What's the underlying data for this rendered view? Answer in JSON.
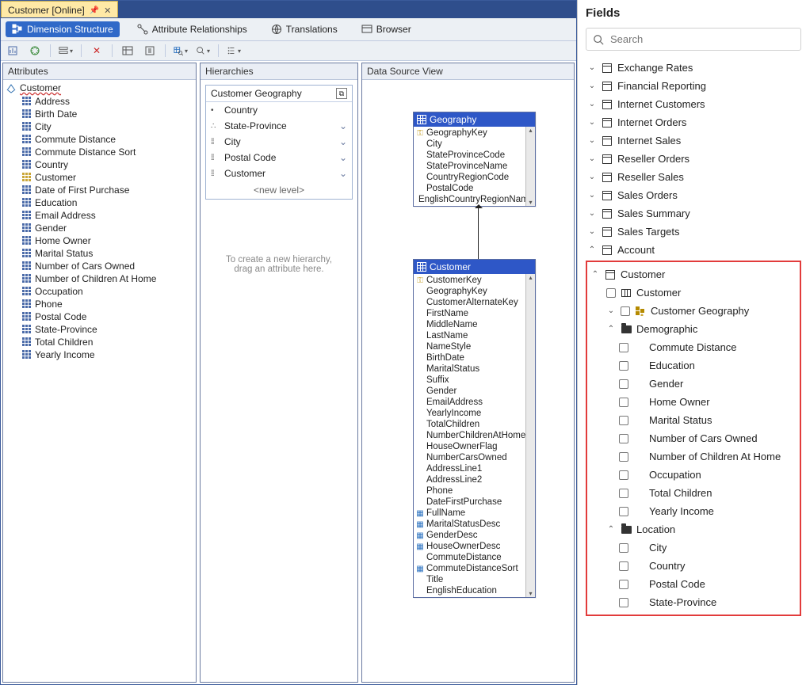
{
  "doc_tab": {
    "title": "Customer [Online]"
  },
  "designer_tabs": {
    "structure": "Dimension Structure",
    "attr_rel": "Attribute Relationships",
    "translations": "Translations",
    "browser": "Browser"
  },
  "panels": {
    "attributes_title": "Attributes",
    "hierarchies_title": "Hierarchies",
    "dsv_title": "Data Source View"
  },
  "attributes": {
    "root": "Customer",
    "items": [
      {
        "label": "Address",
        "key": false
      },
      {
        "label": "Birth Date",
        "key": false
      },
      {
        "label": "City",
        "key": false
      },
      {
        "label": "Commute Distance",
        "key": false
      },
      {
        "label": "Commute Distance Sort",
        "key": false
      },
      {
        "label": "Country",
        "key": false
      },
      {
        "label": "Customer",
        "key": true
      },
      {
        "label": "Date of First Purchase",
        "key": false
      },
      {
        "label": "Education",
        "key": false
      },
      {
        "label": "Email Address",
        "key": false
      },
      {
        "label": "Gender",
        "key": false
      },
      {
        "label": "Home Owner",
        "key": false
      },
      {
        "label": "Marital Status",
        "key": false
      },
      {
        "label": "Number of Cars Owned",
        "key": false
      },
      {
        "label": "Number of Children At Home",
        "key": false
      },
      {
        "label": "Occupation",
        "key": false
      },
      {
        "label": "Phone",
        "key": false
      },
      {
        "label": "Postal Code",
        "key": false
      },
      {
        "label": "State-Province",
        "key": false
      },
      {
        "label": "Total Children",
        "key": false
      },
      {
        "label": "Yearly Income",
        "key": false
      }
    ]
  },
  "hierarchy": {
    "name": "Customer Geography",
    "levels": [
      {
        "dots": "•",
        "label": "Country",
        "chev": false
      },
      {
        "dots": "∴",
        "label": "State-Province",
        "chev": true
      },
      {
        "dots": "⁞⁞",
        "label": "City",
        "chev": true
      },
      {
        "dots": "⁞⁞",
        "label": "Postal Code",
        "chev": true
      },
      {
        "dots": "⁞⁞",
        "label": "Customer",
        "chev": true
      }
    ],
    "new_level": "<new level>",
    "hint_line1": "To create a new hierarchy,",
    "hint_line2": "drag an attribute here."
  },
  "dsv": {
    "geo": {
      "name": "Geography",
      "cols": [
        {
          "n": "GeographyKey",
          "k": "key"
        },
        {
          "n": "City",
          "k": ""
        },
        {
          "n": "StateProvinceCode",
          "k": ""
        },
        {
          "n": "StateProvinceName",
          "k": ""
        },
        {
          "n": "CountryRegionCode",
          "k": ""
        },
        {
          "n": "PostalCode",
          "k": ""
        },
        {
          "n": "EnglishCountryRegionName",
          "k": ""
        }
      ]
    },
    "cust": {
      "name": "Customer",
      "cols": [
        {
          "n": "CustomerKey",
          "k": "key"
        },
        {
          "n": "GeographyKey",
          "k": ""
        },
        {
          "n": "CustomerAlternateKey",
          "k": ""
        },
        {
          "n": "FirstName",
          "k": ""
        },
        {
          "n": "MiddleName",
          "k": ""
        },
        {
          "n": "LastName",
          "k": ""
        },
        {
          "n": "NameStyle",
          "k": ""
        },
        {
          "n": "BirthDate",
          "k": ""
        },
        {
          "n": "MaritalStatus",
          "k": ""
        },
        {
          "n": "Suffix",
          "k": ""
        },
        {
          "n": "Gender",
          "k": ""
        },
        {
          "n": "EmailAddress",
          "k": ""
        },
        {
          "n": "YearlyIncome",
          "k": ""
        },
        {
          "n": "TotalChildren",
          "k": ""
        },
        {
          "n": "NumberChildrenAtHome",
          "k": ""
        },
        {
          "n": "HouseOwnerFlag",
          "k": ""
        },
        {
          "n": "NumberCarsOwned",
          "k": ""
        },
        {
          "n": "AddressLine1",
          "k": ""
        },
        {
          "n": "AddressLine2",
          "k": ""
        },
        {
          "n": "Phone",
          "k": ""
        },
        {
          "n": "DateFirstPurchase",
          "k": ""
        },
        {
          "n": "FullName",
          "k": "calc"
        },
        {
          "n": "MaritalStatusDesc",
          "k": "calc"
        },
        {
          "n": "GenderDesc",
          "k": "calc"
        },
        {
          "n": "HouseOwnerDesc",
          "k": "calc"
        },
        {
          "n": "CommuteDistance",
          "k": ""
        },
        {
          "n": "CommuteDistanceSort",
          "k": "calc"
        },
        {
          "n": "Title",
          "k": ""
        },
        {
          "n": "EnglishEducation",
          "k": ""
        }
      ]
    }
  },
  "fields": {
    "title": "Fields",
    "search_placeholder": "Search",
    "tables_top": [
      "Exchange Rates",
      "Financial Reporting",
      "Internet Customers",
      "Internet Orders",
      "Internet Sales",
      "Reseller Orders",
      "Reseller Sales",
      "Sales Orders",
      "Sales Summary",
      "Sales Targets",
      "Account"
    ],
    "customer_table": "Customer",
    "customer_col": "Customer",
    "customer_geo": "Customer Geography",
    "demographic_folder": "Demographic",
    "demographic_items": [
      "Commute Distance",
      "Education",
      "Gender",
      "Home Owner",
      "Marital Status",
      "Number of Cars Owned",
      "Number of Children At Home",
      "Occupation",
      "Total Children",
      "Yearly Income"
    ],
    "location_folder": "Location",
    "location_items": [
      "City",
      "Country",
      "Postal Code",
      "State-Province"
    ]
  }
}
